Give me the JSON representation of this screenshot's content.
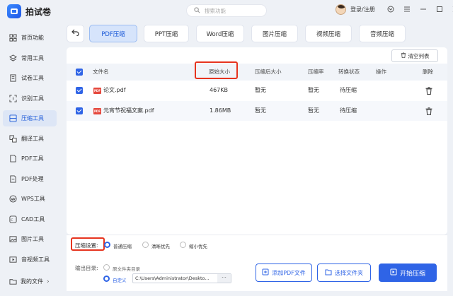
{
  "app": {
    "name": "拍试卷"
  },
  "search": {
    "placeholder": "搜索功能"
  },
  "user": {
    "login_label": "登录/注册"
  },
  "window_controls": [
    "chevron-down-icon",
    "menu-icon",
    "minimize-icon",
    "maximize-icon",
    "close-icon"
  ],
  "sidebar": {
    "items": [
      {
        "label": "首页功能",
        "icon": "home-icon",
        "active": false
      },
      {
        "label": "常用工具",
        "icon": "layers-icon",
        "active": false
      },
      {
        "label": "试卷工具",
        "icon": "exam-icon",
        "active": false
      },
      {
        "label": "识别工具",
        "icon": "scan-icon",
        "active": false
      },
      {
        "label": "压缩工具",
        "icon": "compress-icon",
        "active": true
      },
      {
        "label": "翻译工具",
        "icon": "translate-icon",
        "active": false
      },
      {
        "label": "PDF工具",
        "icon": "pdf-tool-icon",
        "active": false
      },
      {
        "label": "PDF处理",
        "icon": "pdf-process-icon",
        "active": false
      },
      {
        "label": "WPS工具",
        "icon": "wps-icon",
        "active": false
      },
      {
        "label": "CAD工具",
        "icon": "cad-icon",
        "active": false
      },
      {
        "label": "图片工具",
        "icon": "image-icon",
        "active": false
      },
      {
        "label": "音视频工具",
        "icon": "media-icon",
        "active": false
      }
    ],
    "my_files": "我的文件"
  },
  "tabs": [
    {
      "label": "PDF压缩",
      "active": true
    },
    {
      "label": "PPT压缩",
      "active": false
    },
    {
      "label": "Word压缩",
      "active": false
    },
    {
      "label": "图片压缩",
      "active": false
    },
    {
      "label": "视频压缩",
      "active": false
    },
    {
      "label": "音频压缩",
      "active": false
    }
  ],
  "toolbar": {
    "clear_list": "清空列表"
  },
  "table": {
    "headers": {
      "file_name": "文件名",
      "original_size": "原始大小",
      "compressed_size": "压缩后大小",
      "ratio": "压缩率",
      "status": "转换状态",
      "action": "操作",
      "delete": "删除"
    },
    "rows": [
      {
        "name": "论文.pdf",
        "size": "467KB",
        "compressed": "暂无",
        "ratio": "暂无",
        "status": "待压缩"
      },
      {
        "name": "元宵节祝福文案.pdf",
        "size": "1.86MB",
        "compressed": "暂无",
        "ratio": "暂无",
        "status": "待压缩"
      }
    ]
  },
  "settings": {
    "label": "压缩设置:",
    "options": [
      "普通压缩",
      "清晰优先",
      "缩小优先"
    ],
    "selected": "普通压缩"
  },
  "output": {
    "label": "输出目录:",
    "options": [
      "原文件夹目录",
      "自定义"
    ],
    "selected": "自定义",
    "path": "C:\\Users\\Administrator\\Deskto...",
    "browse": "···"
  },
  "actions": {
    "add_pdf": "添加PDF文件",
    "select_folder": "选择文件夹",
    "start": "开始压缩"
  },
  "colors": {
    "accent": "#2f64e6",
    "highlight": "#e6341f",
    "active_tab": "#d6e4fb"
  }
}
